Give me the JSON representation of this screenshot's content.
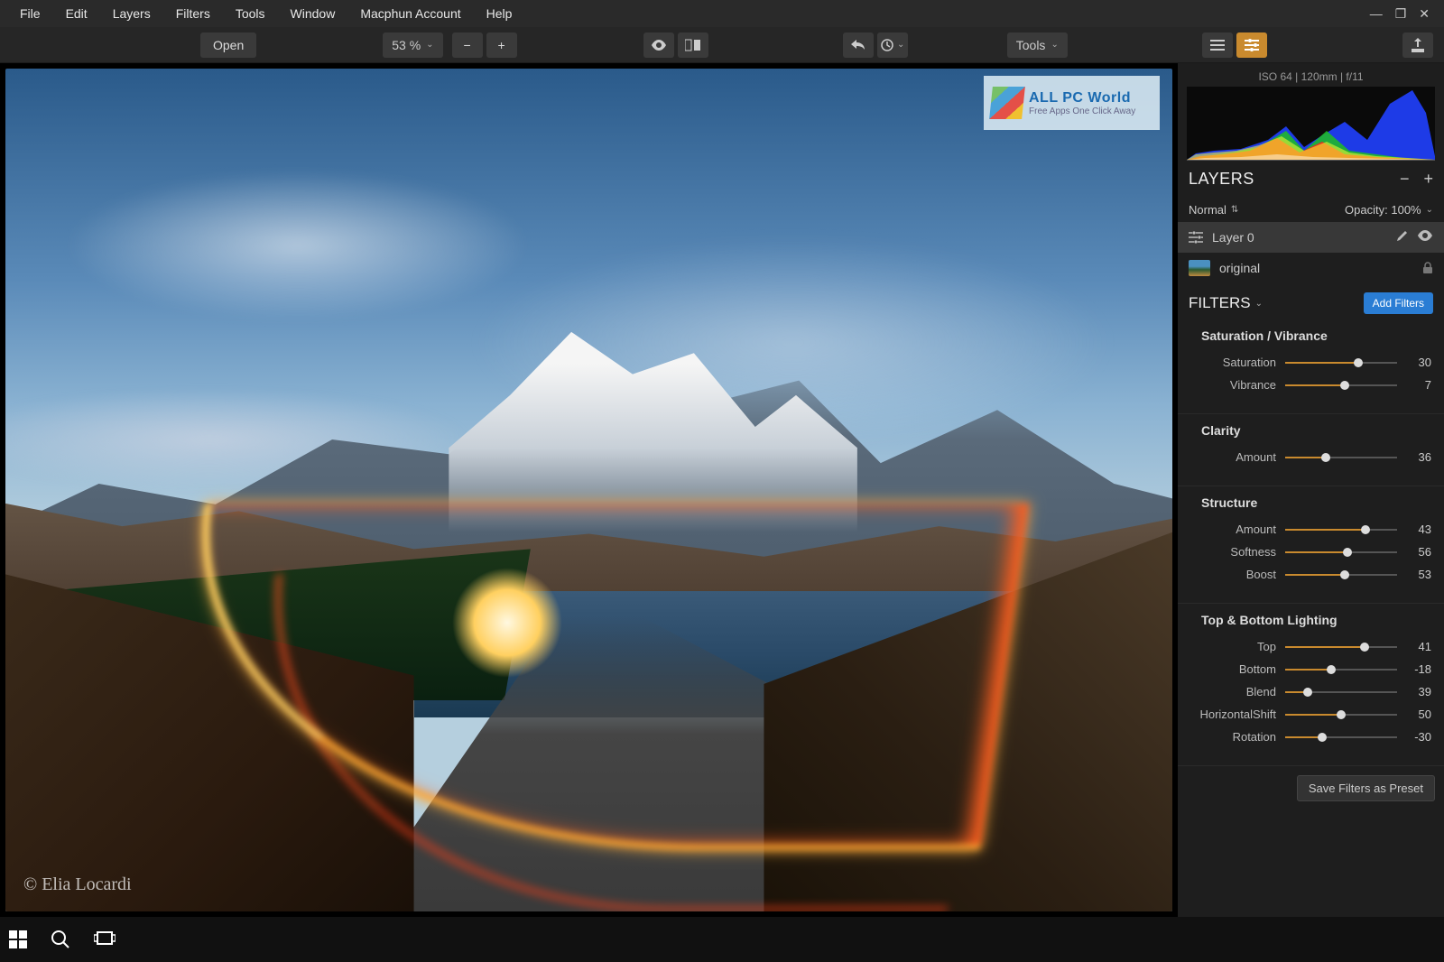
{
  "menu": {
    "file": "File",
    "edit": "Edit",
    "layers": "Layers",
    "filters": "Filters",
    "tools": "Tools",
    "window": "Window",
    "account": "Macphun Account",
    "help": "Help"
  },
  "toolbar": {
    "open": "Open",
    "zoom": "53 %",
    "tools": "Tools"
  },
  "histogram": {
    "info": "ISO 64  |  120mm  |  f/11"
  },
  "layers": {
    "title": "LAYERS",
    "blend": "Normal",
    "opacity_label": "Opacity:",
    "opacity_value": "100%",
    "items": [
      {
        "name": "Layer 0"
      },
      {
        "name": "original"
      }
    ]
  },
  "filters": {
    "title": "FILTERS",
    "add_btn": "Add Filters",
    "save_preset": "Save Filters as Preset",
    "groups": [
      {
        "title": "Saturation / Vibrance",
        "sliders": [
          {
            "label": "Saturation",
            "value": 30,
            "pos": 65
          },
          {
            "label": "Vibrance",
            "value": 7,
            "pos": 53
          }
        ]
      },
      {
        "title": "Clarity",
        "sliders": [
          {
            "label": "Amount",
            "value": 36,
            "pos": 36
          }
        ]
      },
      {
        "title": "Structure",
        "sliders": [
          {
            "label": "Amount",
            "value": 43,
            "pos": 72
          },
          {
            "label": "Softness",
            "value": 56,
            "pos": 56
          },
          {
            "label": "Boost",
            "value": 53,
            "pos": 53
          }
        ]
      },
      {
        "title": "Top & Bottom Lighting",
        "sliders": [
          {
            "label": "Top",
            "value": 41,
            "pos": 71
          },
          {
            "label": "Bottom",
            "value": -18,
            "pos": 41
          },
          {
            "label": "Blend",
            "value": 39,
            "pos": 20
          },
          {
            "label": "HorizontalShift",
            "value": 50,
            "pos": 50
          },
          {
            "label": "Rotation",
            "value": -30,
            "pos": 33
          }
        ]
      }
    ]
  },
  "image": {
    "credit": "© Elia Locardi"
  },
  "watermark": {
    "title": "ALL PC World",
    "subtitle": "Free Apps One Click Away"
  }
}
